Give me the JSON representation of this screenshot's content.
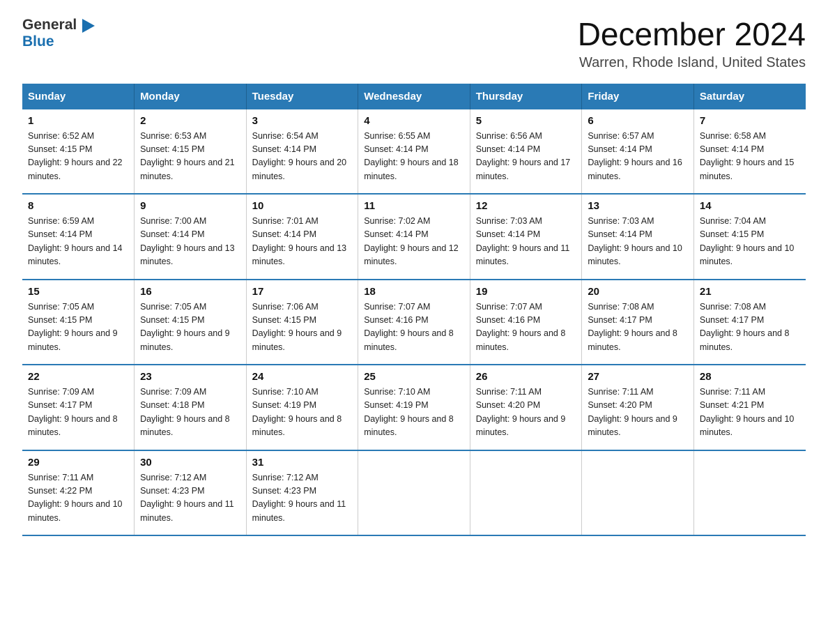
{
  "header": {
    "title": "December 2024",
    "subtitle": "Warren, Rhode Island, United States",
    "logo_general": "General",
    "logo_blue": "Blue"
  },
  "columns": [
    "Sunday",
    "Monday",
    "Tuesday",
    "Wednesday",
    "Thursday",
    "Friday",
    "Saturday"
  ],
  "weeks": [
    [
      {
        "day": "1",
        "sunrise": "Sunrise: 6:52 AM",
        "sunset": "Sunset: 4:15 PM",
        "daylight": "Daylight: 9 hours and 22 minutes."
      },
      {
        "day": "2",
        "sunrise": "Sunrise: 6:53 AM",
        "sunset": "Sunset: 4:15 PM",
        "daylight": "Daylight: 9 hours and 21 minutes."
      },
      {
        "day": "3",
        "sunrise": "Sunrise: 6:54 AM",
        "sunset": "Sunset: 4:14 PM",
        "daylight": "Daylight: 9 hours and 20 minutes."
      },
      {
        "day": "4",
        "sunrise": "Sunrise: 6:55 AM",
        "sunset": "Sunset: 4:14 PM",
        "daylight": "Daylight: 9 hours and 18 minutes."
      },
      {
        "day": "5",
        "sunrise": "Sunrise: 6:56 AM",
        "sunset": "Sunset: 4:14 PM",
        "daylight": "Daylight: 9 hours and 17 minutes."
      },
      {
        "day": "6",
        "sunrise": "Sunrise: 6:57 AM",
        "sunset": "Sunset: 4:14 PM",
        "daylight": "Daylight: 9 hours and 16 minutes."
      },
      {
        "day": "7",
        "sunrise": "Sunrise: 6:58 AM",
        "sunset": "Sunset: 4:14 PM",
        "daylight": "Daylight: 9 hours and 15 minutes."
      }
    ],
    [
      {
        "day": "8",
        "sunrise": "Sunrise: 6:59 AM",
        "sunset": "Sunset: 4:14 PM",
        "daylight": "Daylight: 9 hours and 14 minutes."
      },
      {
        "day": "9",
        "sunrise": "Sunrise: 7:00 AM",
        "sunset": "Sunset: 4:14 PM",
        "daylight": "Daylight: 9 hours and 13 minutes."
      },
      {
        "day": "10",
        "sunrise": "Sunrise: 7:01 AM",
        "sunset": "Sunset: 4:14 PM",
        "daylight": "Daylight: 9 hours and 13 minutes."
      },
      {
        "day": "11",
        "sunrise": "Sunrise: 7:02 AM",
        "sunset": "Sunset: 4:14 PM",
        "daylight": "Daylight: 9 hours and 12 minutes."
      },
      {
        "day": "12",
        "sunrise": "Sunrise: 7:03 AM",
        "sunset": "Sunset: 4:14 PM",
        "daylight": "Daylight: 9 hours and 11 minutes."
      },
      {
        "day": "13",
        "sunrise": "Sunrise: 7:03 AM",
        "sunset": "Sunset: 4:14 PM",
        "daylight": "Daylight: 9 hours and 10 minutes."
      },
      {
        "day": "14",
        "sunrise": "Sunrise: 7:04 AM",
        "sunset": "Sunset: 4:15 PM",
        "daylight": "Daylight: 9 hours and 10 minutes."
      }
    ],
    [
      {
        "day": "15",
        "sunrise": "Sunrise: 7:05 AM",
        "sunset": "Sunset: 4:15 PM",
        "daylight": "Daylight: 9 hours and 9 minutes."
      },
      {
        "day": "16",
        "sunrise": "Sunrise: 7:05 AM",
        "sunset": "Sunset: 4:15 PM",
        "daylight": "Daylight: 9 hours and 9 minutes."
      },
      {
        "day": "17",
        "sunrise": "Sunrise: 7:06 AM",
        "sunset": "Sunset: 4:15 PM",
        "daylight": "Daylight: 9 hours and 9 minutes."
      },
      {
        "day": "18",
        "sunrise": "Sunrise: 7:07 AM",
        "sunset": "Sunset: 4:16 PM",
        "daylight": "Daylight: 9 hours and 8 minutes."
      },
      {
        "day": "19",
        "sunrise": "Sunrise: 7:07 AM",
        "sunset": "Sunset: 4:16 PM",
        "daylight": "Daylight: 9 hours and 8 minutes."
      },
      {
        "day": "20",
        "sunrise": "Sunrise: 7:08 AM",
        "sunset": "Sunset: 4:17 PM",
        "daylight": "Daylight: 9 hours and 8 minutes."
      },
      {
        "day": "21",
        "sunrise": "Sunrise: 7:08 AM",
        "sunset": "Sunset: 4:17 PM",
        "daylight": "Daylight: 9 hours and 8 minutes."
      }
    ],
    [
      {
        "day": "22",
        "sunrise": "Sunrise: 7:09 AM",
        "sunset": "Sunset: 4:17 PM",
        "daylight": "Daylight: 9 hours and 8 minutes."
      },
      {
        "day": "23",
        "sunrise": "Sunrise: 7:09 AM",
        "sunset": "Sunset: 4:18 PM",
        "daylight": "Daylight: 9 hours and 8 minutes."
      },
      {
        "day": "24",
        "sunrise": "Sunrise: 7:10 AM",
        "sunset": "Sunset: 4:19 PM",
        "daylight": "Daylight: 9 hours and 8 minutes."
      },
      {
        "day": "25",
        "sunrise": "Sunrise: 7:10 AM",
        "sunset": "Sunset: 4:19 PM",
        "daylight": "Daylight: 9 hours and 8 minutes."
      },
      {
        "day": "26",
        "sunrise": "Sunrise: 7:11 AM",
        "sunset": "Sunset: 4:20 PM",
        "daylight": "Daylight: 9 hours and 9 minutes."
      },
      {
        "day": "27",
        "sunrise": "Sunrise: 7:11 AM",
        "sunset": "Sunset: 4:20 PM",
        "daylight": "Daylight: 9 hours and 9 minutes."
      },
      {
        "day": "28",
        "sunrise": "Sunrise: 7:11 AM",
        "sunset": "Sunset: 4:21 PM",
        "daylight": "Daylight: 9 hours and 10 minutes."
      }
    ],
    [
      {
        "day": "29",
        "sunrise": "Sunrise: 7:11 AM",
        "sunset": "Sunset: 4:22 PM",
        "daylight": "Daylight: 9 hours and 10 minutes."
      },
      {
        "day": "30",
        "sunrise": "Sunrise: 7:12 AM",
        "sunset": "Sunset: 4:23 PM",
        "daylight": "Daylight: 9 hours and 11 minutes."
      },
      {
        "day": "31",
        "sunrise": "Sunrise: 7:12 AM",
        "sunset": "Sunset: 4:23 PM",
        "daylight": "Daylight: 9 hours and 11 minutes."
      },
      null,
      null,
      null,
      null
    ]
  ]
}
